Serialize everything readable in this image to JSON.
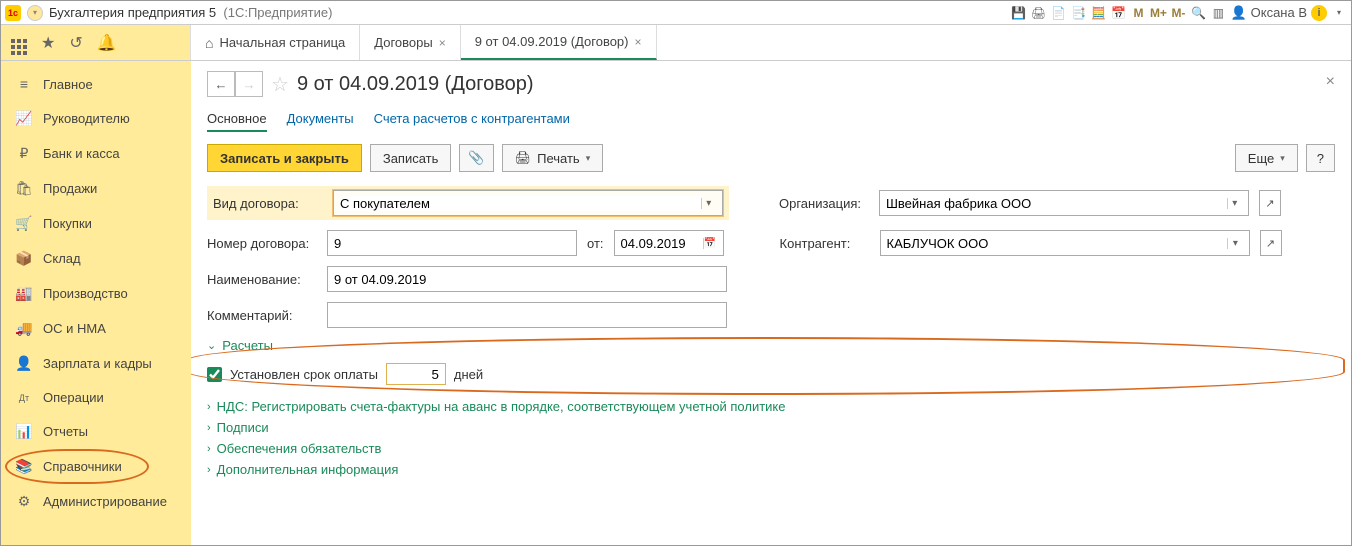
{
  "titlebar": {
    "app": "Бухгалтерия предприятия 5",
    "platform": "(1С:Предприятие)",
    "user": "Оксана В",
    "m_buttons": [
      "M",
      "M+",
      "M-"
    ]
  },
  "tabs": {
    "home": "Начальная страница",
    "t1": "Договоры",
    "t2": "9 от 04.09.2019 (Договор)"
  },
  "sidebar": {
    "items": [
      {
        "icon": "≡",
        "label": "Главное"
      },
      {
        "icon": "📈",
        "label": "Руководителю"
      },
      {
        "icon": "₽",
        "label": "Банк и касса"
      },
      {
        "icon": "🛍",
        "label": "Продажи"
      },
      {
        "icon": "🛒",
        "label": "Покупки"
      },
      {
        "icon": "📦",
        "label": "Склад"
      },
      {
        "icon": "🏭",
        "label": "Производство"
      },
      {
        "icon": "🚚",
        "label": "ОС и НМА"
      },
      {
        "icon": "👤",
        "label": "Зарплата и кадры"
      },
      {
        "icon": "Дт",
        "label": "Операции"
      },
      {
        "icon": "📊",
        "label": "Отчеты"
      },
      {
        "icon": "📚",
        "label": "Справочники"
      },
      {
        "icon": "⚙",
        "label": "Администрирование"
      }
    ]
  },
  "page": {
    "title": "9 от 04.09.2019 (Договор)",
    "subtabs": {
      "main": "Основное",
      "docs": "Документы",
      "accounts": "Счета расчетов с контрагентами"
    },
    "buttons": {
      "save_close": "Записать и закрыть",
      "save": "Записать",
      "print": "Печать",
      "more": "Еще",
      "help": "?"
    },
    "form": {
      "contract_type_label": "Вид договора:",
      "contract_type": "С покупателем",
      "org_label": "Организация:",
      "org": "Швейная фабрика ООО",
      "num_label": "Номер договора:",
      "num": "9",
      "from_label": "от:",
      "from_date": "04.09.2019",
      "counterparty_label": "Контрагент:",
      "counterparty": "КАБЛУЧОК ООО",
      "name_label": "Наименование:",
      "name": "9 от 04.09.2019",
      "comment_label": "Комментарий:",
      "comment": ""
    },
    "sections": {
      "payments": "Расчеты",
      "payment_term_label": "Установлен срок оплаты",
      "payment_days": "5",
      "days_suffix": "дней",
      "vat": "НДС: Регистрировать счета-фактуры на аванс в порядке, соответствующем учетной политике",
      "signs": "Подписи",
      "collateral": "Обеспечения обязательств",
      "extra": "Дополнительная информация"
    }
  }
}
